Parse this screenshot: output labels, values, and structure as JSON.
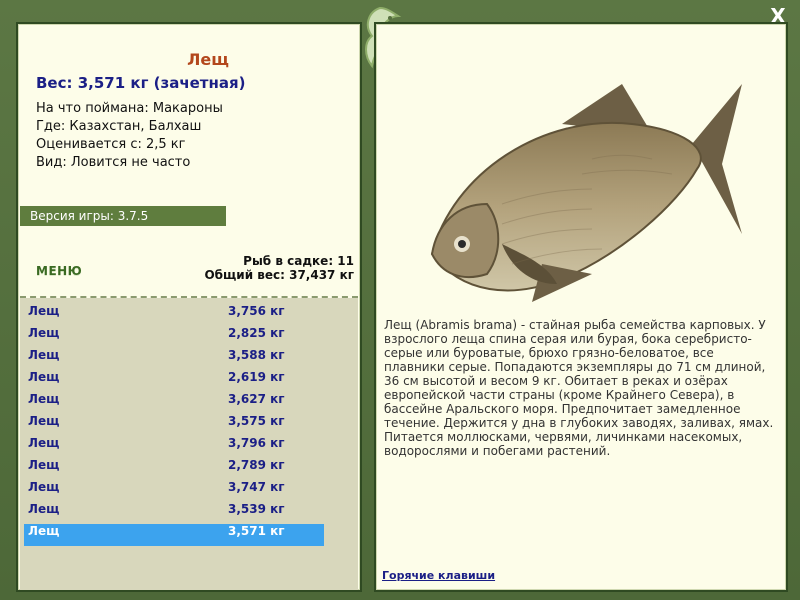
{
  "fish": {
    "title": "Лещ",
    "weight_line": "Вес: 3,571 кг (зачетная)",
    "caught_on": "На что поймана: Макароны",
    "where": "Где: Казахстан, Балхаш",
    "rated_from": "Оценивается с: 2,5 кг",
    "type": "Вид: Ловится не часто"
  },
  "version": "Версия игры: 3.7.5",
  "menu_label": "МЕНЮ",
  "stats": {
    "fish_count": "Рыб в садке: 11",
    "total_weight": "Общий вес: 37,437 кг"
  },
  "catch_list": [
    {
      "name": "Лещ",
      "weight": "3,756 кг"
    },
    {
      "name": "Лещ",
      "weight": "2,825 кг"
    },
    {
      "name": "Лещ",
      "weight": "3,588 кг"
    },
    {
      "name": "Лещ",
      "weight": "2,619 кг"
    },
    {
      "name": "Лещ",
      "weight": "3,627 кг"
    },
    {
      "name": "Лещ",
      "weight": "3,575 кг"
    },
    {
      "name": "Лещ",
      "weight": "3,796 кг"
    },
    {
      "name": "Лещ",
      "weight": "2,789 кг"
    },
    {
      "name": "Лещ",
      "weight": "3,747 кг"
    },
    {
      "name": "Лещ",
      "weight": "3,539 кг"
    },
    {
      "name": "Лещ",
      "weight": "3,571 кг"
    }
  ],
  "description": "Лещ (Abramis brama) - стайная рыба семейства карповых. У взрослого леща спина серая или бурая, бока серебристо-серые или буроватые, брюхо грязно-беловатое, все плавники серые. Попадаются экземпляры до 71 см длиной, 36 см высотой и весом 9 кг. Обитает в реках и озёрах европейской части страны (кроме Крайнего Севера), в бассейне Аральского моря. Предпочитает замедленное течение. Держится у дна в глубоких заводях, заливах, ямах. Питается моллюсками, червями, личинками насекомых, водорослями и побегами растений.",
  "hotkeys_label": "Горячие клавиши",
  "close_label": "X",
  "colors": {
    "frame": "#56703f",
    "panel": "#fdfde9",
    "title": "#b3471c",
    "weight": "#1b1f86",
    "selected_row": "#3ca3ee",
    "list_bg": "#d8d7bc"
  },
  "icons": {
    "logo": "fish-logo-icon",
    "close": "close-icon"
  }
}
